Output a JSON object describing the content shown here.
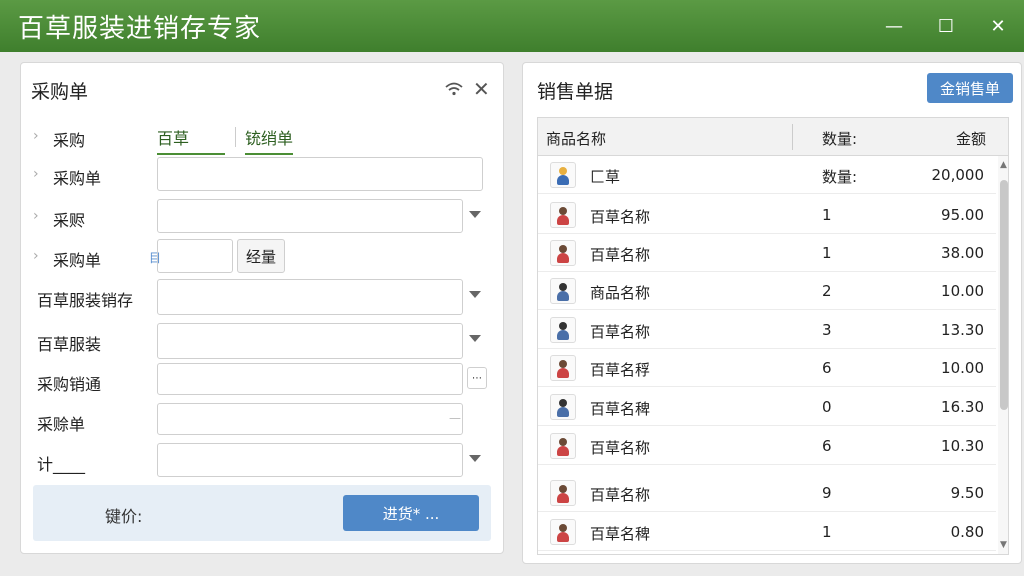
{
  "app": {
    "title": "百草服装进销存专家"
  },
  "window_controls": {
    "minimize": "—",
    "maximize": "☐",
    "close": "✕"
  },
  "purchase": {
    "title": "采购单",
    "tab_a": "百草",
    "tab_b": "铳绡单",
    "rows": {
      "r1": "采购",
      "r2": "采购单",
      "r3": "采赆",
      "r4": "采购单",
      "r5": "百草服装销存",
      "r6": "百草服装",
      "r7": "采购销通",
      "r8": "采赊单",
      "r9": "计____"
    },
    "small_button": "经量",
    "footer_label": "键价:",
    "submit_label": "进货* ..."
  },
  "sales": {
    "title": "销售单据",
    "top_button": "金销售单",
    "columns": {
      "name": "商品名称",
      "qty": "数量:",
      "amount": "金额"
    },
    "rows": [
      {
        "name": "匚草",
        "qty": "数量:",
        "amount": "20,000",
        "icon": "clothing-icon"
      },
      {
        "name": "百草名称",
        "qty": "1",
        "amount": "95.00",
        "icon": "person-icon"
      },
      {
        "name": "百草名称",
        "qty": "1",
        "amount": "38.00",
        "icon": "person-icon"
      },
      {
        "name": "商品名称",
        "qty": "2",
        "amount": "10.00",
        "icon": "product-icon"
      },
      {
        "name": "百草名称",
        "qty": "3",
        "amount": "13.30",
        "icon": "product-icon"
      },
      {
        "name": "百草名稃",
        "qty": "6",
        "amount": "10.00",
        "icon": "person-icon"
      },
      {
        "name": "百草名稗",
        "qty": "0",
        "amount": "16.30",
        "icon": "product-icon"
      },
      {
        "name": "百草名称",
        "qty": "6",
        "amount": "10.30",
        "icon": "person-icon"
      },
      {
        "name": "百草名称",
        "qty": "9",
        "amount": "9.50",
        "icon": "person-icon"
      },
      {
        "name": "百草名稗",
        "qty": "1",
        "amount": "0.80",
        "icon": "person-icon"
      }
    ]
  },
  "colors": {
    "titlebar": "#4a8a36",
    "accent_blue": "#4f88c8"
  }
}
